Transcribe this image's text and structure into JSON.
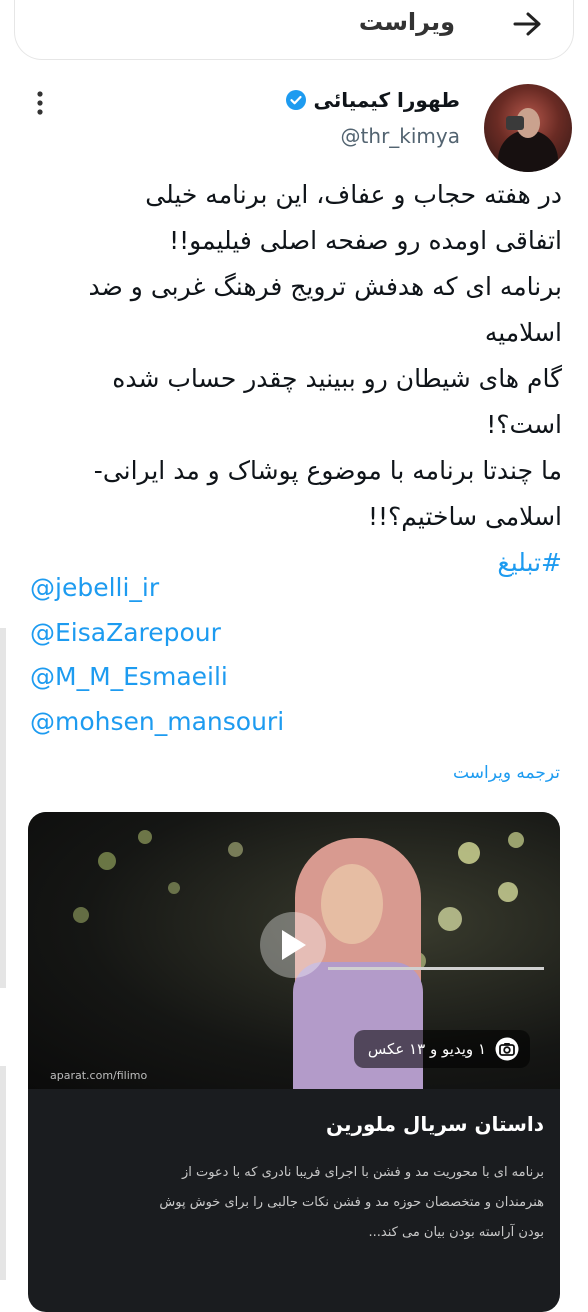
{
  "header": {
    "title": "ویراست",
    "back_icon": "arrow-right-icon"
  },
  "author": {
    "name": "طهورا کیمیائی",
    "handle": "@thr_kimya",
    "verified_color": "#1d9bf0"
  },
  "tweet": {
    "lines": [
      "در هفته حجاب و عفاف، این برنامه خیلی",
      "اتفاقی اومده رو صفحه اصلی فیلیمو!!",
      "برنامه ای که هدفش ترویج فرهنگ غربی و ضد",
      "اسلامیه",
      "گام های شیطان رو ببینید چقدر حساب شده",
      "است؟!",
      "ما چندتا برنامه با موضوع پوشاک و مد ایرانی-",
      "اسلامی ساختیم؟!!"
    ],
    "hashtag": "#تبلیغ",
    "mentions": [
      "@jebelli_ir",
      "@EisaZarepour",
      "@M_M_Esmaeili",
      "@mohsen_mansouri"
    ],
    "translate_label": "ترجمه ویراست"
  },
  "card": {
    "media_badge": "۱ ویدیو و ۱۳ عکس",
    "watermark": "aparat.com/filimo",
    "title": "داستان سریال ملورین",
    "description": [
      "برنامه ای با محوریت مد و فشن با اجرای فریبا نادری که با دعوت از",
      "هنرمندان و متخصصان حوزه مد و فشن نکات جالبی را برای خوش پوش",
      "بودن آراسته بودن بیان می کند..."
    ]
  },
  "colors": {
    "accent": "#1d9bf0",
    "card_bg": "#1a1c1f"
  }
}
